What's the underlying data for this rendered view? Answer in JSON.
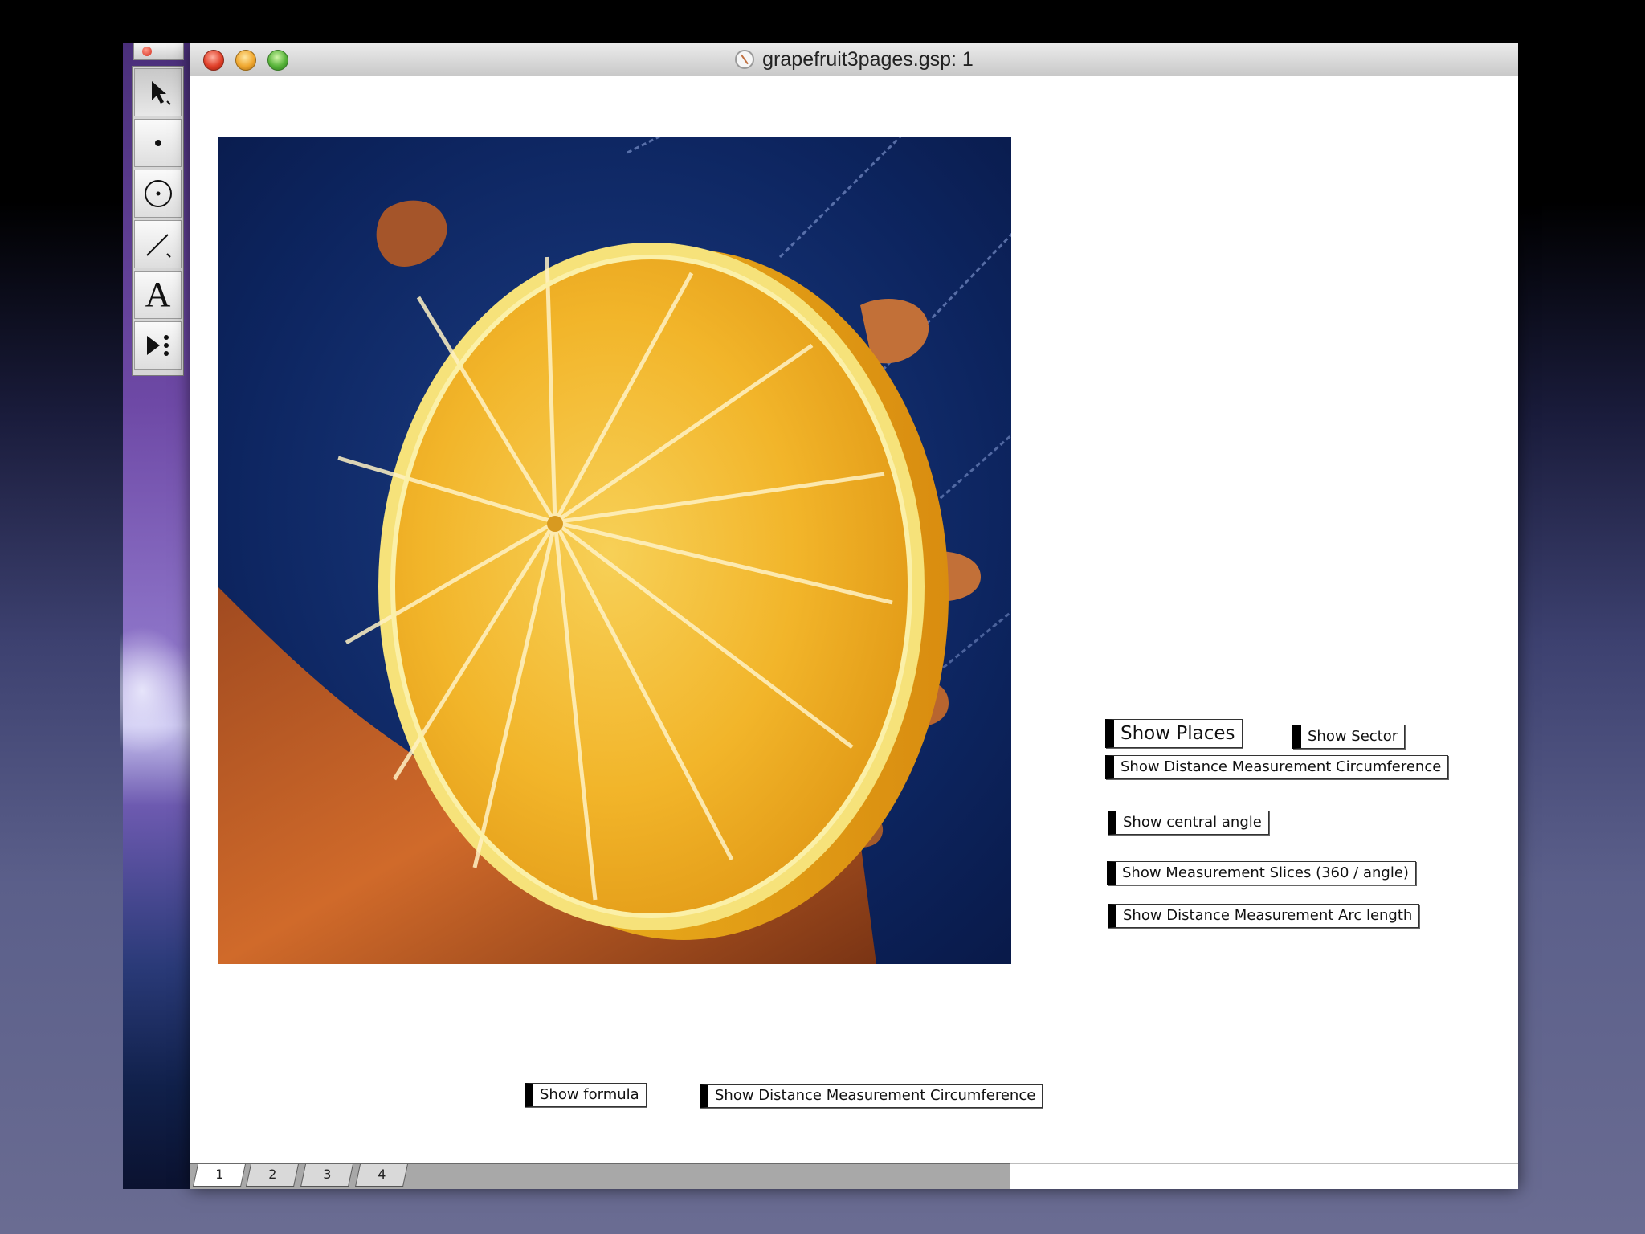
{
  "window": {
    "title": "grapefruit3pages.gsp: 1"
  },
  "toolbox": {
    "tools": [
      {
        "name": "arrow-tool",
        "icon": "arrow-icon"
      },
      {
        "name": "point-tool",
        "icon": "point-icon"
      },
      {
        "name": "compass-tool",
        "icon": "compass-icon"
      },
      {
        "name": "straightedge-tool",
        "icon": "straightedge-icon"
      },
      {
        "name": "text-tool",
        "icon": "text-icon",
        "glyph": "A"
      },
      {
        "name": "custom-tool",
        "icon": "custom-tool-icon"
      }
    ]
  },
  "buttons": {
    "show_places": "Show Places",
    "show_sector": "Show Sector",
    "show_distance_circumference_right": "Show Distance Measurement Circumference",
    "show_central_angle": "Show central angle",
    "show_measurement_slices": "Show Measurement Slices (360 / angle)",
    "show_distance_arc_length": "Show Distance Measurement Arc length",
    "show_formula": "Show formula",
    "show_distance_circumference_bottom": "Show Distance Measurement Circumference"
  },
  "pages": {
    "tabs": [
      "1",
      "2",
      "3",
      "4"
    ],
    "active": "1"
  },
  "colors": {
    "photo_background": "#0b1f5a",
    "fruit": "#f2b21e",
    "rind": "#f6e27a",
    "hand": "#c0622a"
  }
}
